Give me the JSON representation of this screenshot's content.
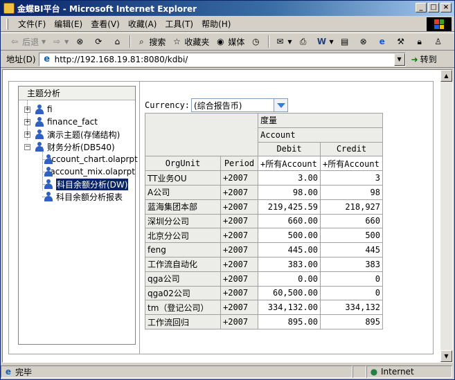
{
  "window": {
    "title": "金蝶BI平台 - Microsoft Internet Explorer",
    "min_label": "_",
    "max_label": "□",
    "close_label": "×"
  },
  "menu": {
    "items": [
      "文件(F)",
      "编辑(E)",
      "查看(V)",
      "收藏(A)",
      "工具(T)",
      "帮助(H)"
    ]
  },
  "toolbar": {
    "back_label": "后退",
    "search_label": "搜索",
    "favorites_label": "收藏夹",
    "media_label": "媒体"
  },
  "address": {
    "label": "地址(D)",
    "url": "http://192.168.19.81:8080/kdbi/",
    "go_label": "转到"
  },
  "left_panel": {
    "header": "主题分析",
    "tree": [
      {
        "label": "fi",
        "expander": "+"
      },
      {
        "label": "finance_fact",
        "expander": "+"
      },
      {
        "label": "演示主题(存储结构)",
        "expander": "+"
      },
      {
        "label": "财务分析(DB540)",
        "expander": "−"
      },
      {
        "label": "account_chart.olaprpt"
      },
      {
        "label": "account_mix.olaprpt"
      },
      {
        "label": "科目余额分析(DW)",
        "selected": true
      },
      {
        "label": "科目余额分析报表"
      }
    ]
  },
  "currency": {
    "label": "Currency:",
    "value": "(综合报告币)"
  },
  "table": {
    "measure_header": "度量",
    "account_header": "Account",
    "debit_header": "Debit",
    "credit_header": "Credit",
    "orgunit_header": "OrgUnit",
    "period_header": "Period",
    "all_account": "+所有Account",
    "rows": [
      {
        "org": "TT业务OU",
        "period": "+2007",
        "debit": "3.00",
        "credit": "3"
      },
      {
        "org": "A公司",
        "period": "+2007",
        "debit": "98.00",
        "credit": "98"
      },
      {
        "org": "蓝海集团本部",
        "period": "+2007",
        "debit": "219,425.59",
        "credit": "218,927"
      },
      {
        "org": "深圳分公司",
        "period": "+2007",
        "debit": "660.00",
        "credit": "660"
      },
      {
        "org": "北京分公司",
        "period": "+2007",
        "debit": "500.00",
        "credit": "500"
      },
      {
        "org": "feng",
        "period": "+2007",
        "debit": "445.00",
        "credit": "445"
      },
      {
        "org": "工作流自动化",
        "period": "+2007",
        "debit": "383.00",
        "credit": "383"
      },
      {
        "org": "qga公司",
        "period": "+2007",
        "debit": "0.00",
        "credit": "0"
      },
      {
        "org": "qga02公司",
        "period": "+2007",
        "debit": "60,500.00",
        "credit": "0"
      },
      {
        "org": "tm（登记公司）",
        "period": "+2007",
        "debit": "334,132.00",
        "credit": "334,132"
      },
      {
        "org": "工作流回归",
        "period": "+2007",
        "debit": "895.00",
        "credit": "895"
      }
    ]
  },
  "status": {
    "text": "完毕",
    "zone": "Internet"
  }
}
